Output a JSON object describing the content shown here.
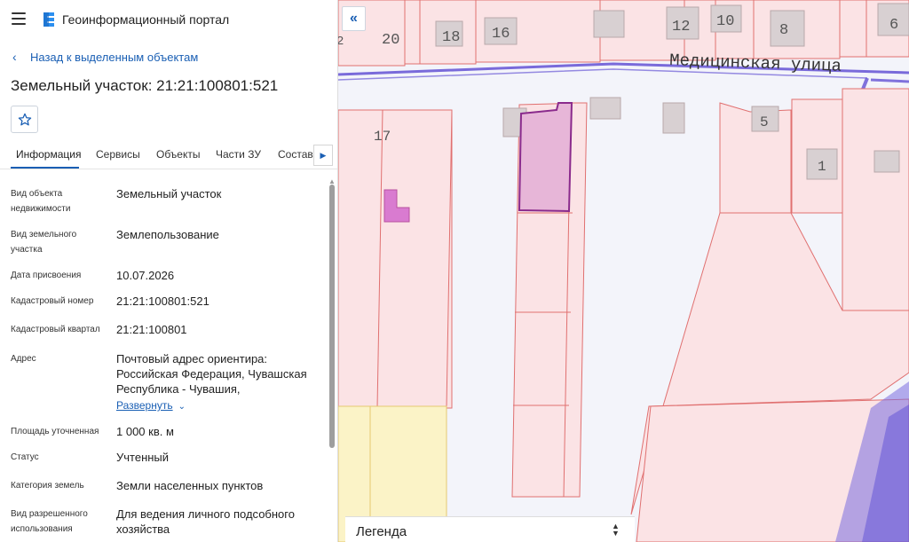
{
  "app": {
    "title": "Геоинформационный портал"
  },
  "nav": {
    "back_label": "Назад к выделенным объектам"
  },
  "page": {
    "title": "Земельный участок: 21:21:100801:521"
  },
  "tabs": [
    {
      "label": "Информация",
      "active": true
    },
    {
      "label": "Сервисы",
      "active": false
    },
    {
      "label": "Объекты",
      "active": false
    },
    {
      "label": "Части ЗУ",
      "active": false
    },
    {
      "label": "Состав",
      "active": false
    }
  ],
  "info": [
    {
      "label": "Вид объекта недвижимости",
      "value": "Земельный участок"
    },
    {
      "label": "Вид земельного участка",
      "value": "Землепользование"
    },
    {
      "label": "Дата присвоения",
      "value": "10.07.2026"
    },
    {
      "label": "Кадастровый номер",
      "value": "21:21:100801:521"
    },
    {
      "label": "Кадастровый квартал",
      "value": "21:21:100801"
    },
    {
      "label": "Адрес",
      "value": "Почтовый адрес ориентира: Российская Федерация, Чувашская Республика - Чувашия,",
      "expand_label": "Развернуть"
    },
    {
      "label": "Площадь уточненная",
      "value": "1 000 кв. м"
    },
    {
      "label": "Статус",
      "value": "Учтенный"
    },
    {
      "label": "Категория земель",
      "value": "Земли населенных пунктов"
    },
    {
      "label": "Вид разрешенного использования",
      "value": "Для ведения личного подсобного хозяйства"
    }
  ],
  "map": {
    "street_name": "Медицинская улица",
    "house_numbers": [
      "2",
      "20",
      "18",
      "16",
      "12",
      "10",
      "8",
      "6",
      "17",
      "5",
      "1"
    ],
    "legend_label": "Легенда",
    "colors": {
      "parcel_fill": "#fbe3e5",
      "parcel_stroke": "#e07070",
      "selected_fill": "#e7b6d8",
      "selected_stroke": "#8a2a8c",
      "street_line": "#6b5bd6",
      "yellow_zone": "#fbf3c7",
      "building_fill": "#d8d0d2",
      "accent": "#1a5fb4"
    }
  }
}
